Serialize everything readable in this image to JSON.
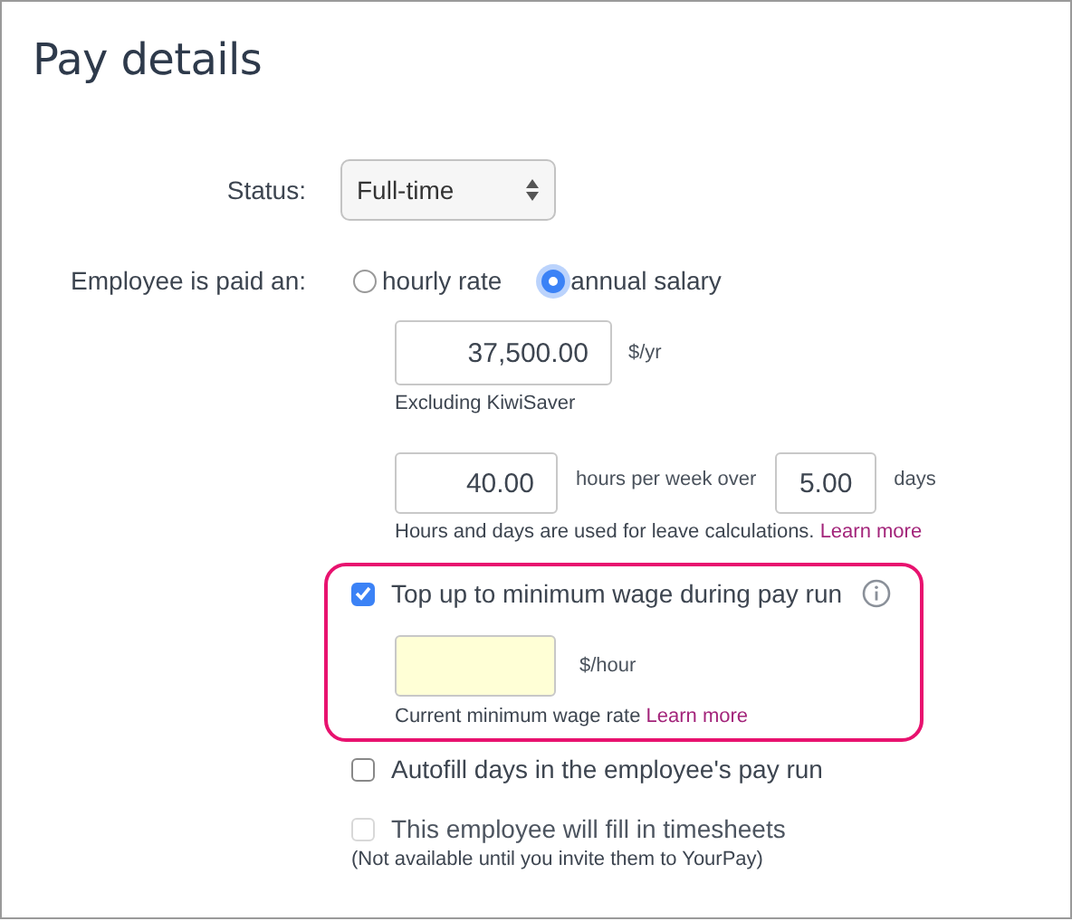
{
  "title": "Pay details",
  "status": {
    "label": "Status:",
    "value": "Full-time"
  },
  "pay_type": {
    "label": "Employee is paid an:",
    "options": [
      {
        "label": "hourly rate",
        "selected": false
      },
      {
        "label": "annual salary",
        "selected": true
      }
    ]
  },
  "salary": {
    "value": "37,500.00",
    "unit": "$/yr",
    "note": "Excluding KiwiSaver"
  },
  "hours": {
    "hours_value": "40.00",
    "between": "hours per week over",
    "days_value": "5.00",
    "unit": "days",
    "note": "Hours and days are used for leave calculations.",
    "link": "Learn more"
  },
  "top_up": {
    "label": "Top up to minimum wage during pay run",
    "checked": true,
    "highlighted": true,
    "unit": "$/hour",
    "note": "Current minimum wage rate",
    "link": "Learn more"
  },
  "options": [
    {
      "label": "Autofill days in the employee's pay run",
      "checked": false,
      "disabled": false
    },
    {
      "label": "This employee will fill in timesheets",
      "checked": false,
      "disabled": true,
      "note": "(Not available until you invite them to YourPay)"
    }
  ]
}
